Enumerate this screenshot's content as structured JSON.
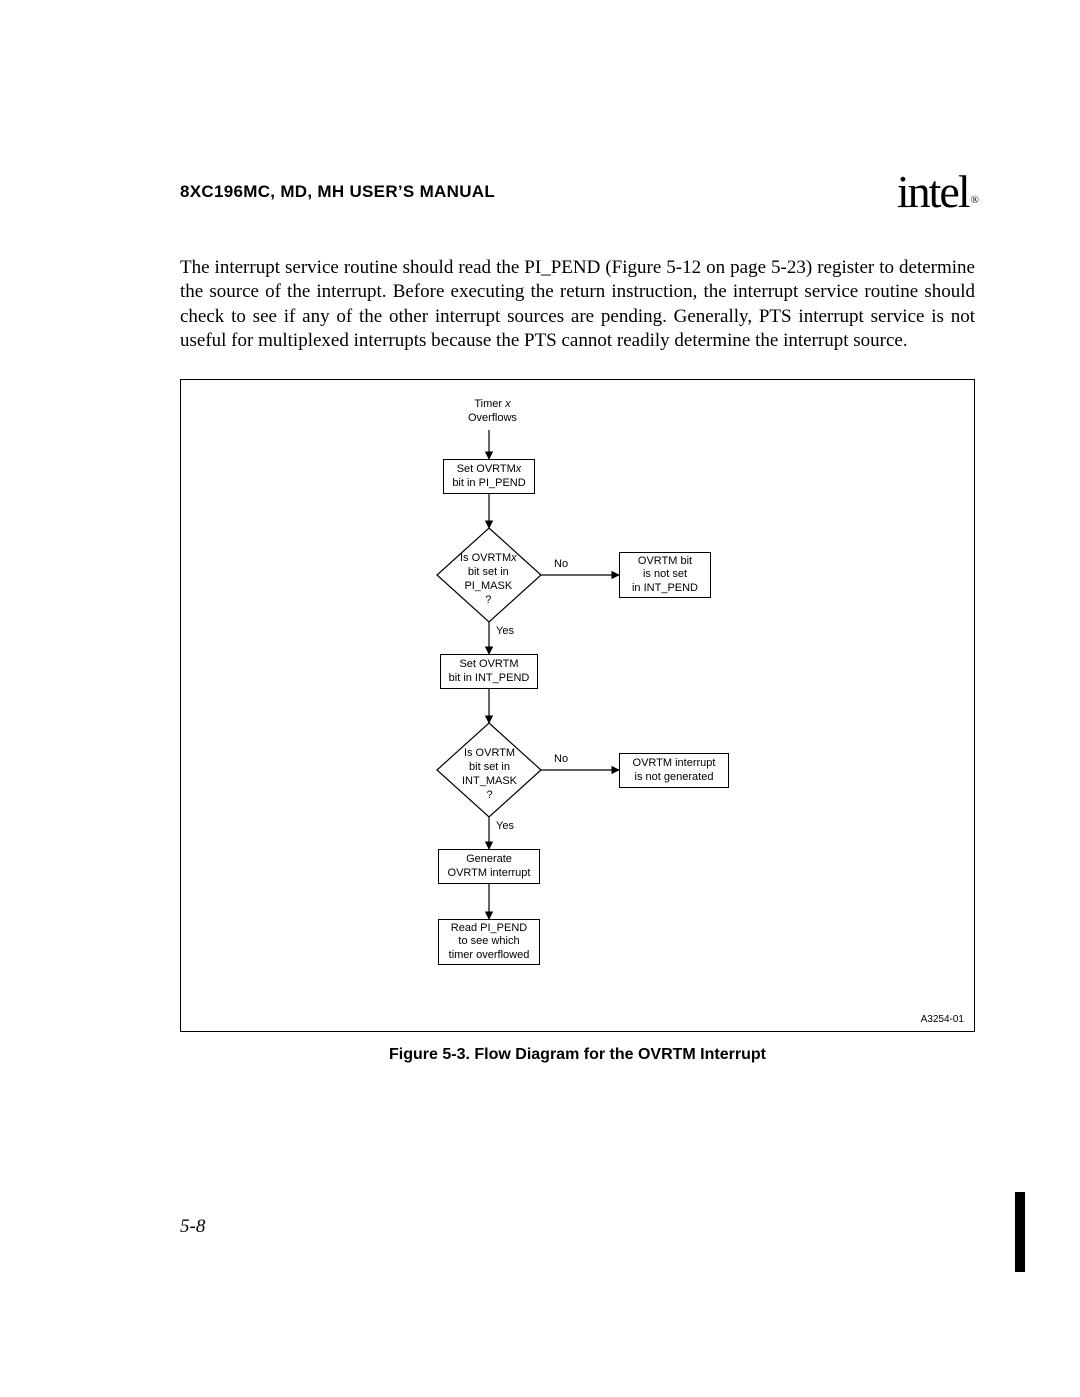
{
  "header": {
    "manual_title": "8XC196MC, MD, MH USER’S MANUAL",
    "logo_text": "intel",
    "logo_reg": "®"
  },
  "paragraph": "The interrupt service routine should read the PI_PEND (Figure 5-12 on page 5-23) register to determine the source of the interrupt. Before executing the return instruction, the interrupt service routine should check to see if any of the other interrupt sources are pending. Generally, PTS interrupt service is not useful for multiplexed interrupts because the PTS cannot readily determine the interrupt source.",
  "flow": {
    "start1": "Timer ",
    "start1_it": "x",
    "start2": "Overflows",
    "box1a": "Set OVRTM",
    "box1a_it": "x",
    "box1b": "bit in PI_PEND",
    "dec1a": "Is OVRTM",
    "dec1a_it": "x",
    "dec1b": "bit set in",
    "dec1c": "PI_MASK",
    "dec1d": "?",
    "dec1_no": "No",
    "dec1_yes": "Yes",
    "side1a": "OVRTM bit",
    "side1b": "is not set",
    "side1c": "in INT_PEND",
    "box2a": "Set OVRTM",
    "box2b": "bit in INT_PEND",
    "dec2a": "Is OVRTM",
    "dec2b": "bit set in",
    "dec2c": "INT_MASK",
    "dec2d": "?",
    "dec2_no": "No",
    "dec2_yes": "Yes",
    "side2a": "OVRTM interrupt",
    "side2b": "is not generated",
    "box3a": "Generate",
    "box3b": "OVRTM interrupt",
    "box4a": "Read PI_PEND",
    "box4b": "to see which",
    "box4c": "timer overflowed",
    "fig_id": "A3254-01"
  },
  "caption": "Figure 5-3.  Flow Diagram for the OVRTM Interrupt",
  "page_number": "5-8",
  "chart_data": {
    "type": "flowchart",
    "nodes": [
      {
        "id": "start",
        "shape": "text",
        "label": "Timer x Overflows"
      },
      {
        "id": "b1",
        "shape": "process",
        "label": "Set OVRTMx bit in PI_PEND"
      },
      {
        "id": "d1",
        "shape": "decision",
        "label": "Is OVRTMx bit set in PI_MASK ?"
      },
      {
        "id": "s1",
        "shape": "process",
        "label": "OVRTM bit is not set in INT_PEND"
      },
      {
        "id": "b2",
        "shape": "process",
        "label": "Set OVRTM bit in INT_PEND"
      },
      {
        "id": "d2",
        "shape": "decision",
        "label": "Is OVRTM bit set in INT_MASK ?"
      },
      {
        "id": "s2",
        "shape": "process",
        "label": "OVRTM interrupt is not generated"
      },
      {
        "id": "b3",
        "shape": "process",
        "label": "Generate OVRTM interrupt"
      },
      {
        "id": "b4",
        "shape": "process",
        "label": "Read PI_PEND to see which timer overflowed"
      }
    ],
    "edges": [
      {
        "from": "start",
        "to": "b1"
      },
      {
        "from": "b1",
        "to": "d1"
      },
      {
        "from": "d1",
        "to": "s1",
        "label": "No"
      },
      {
        "from": "d1",
        "to": "b2",
        "label": "Yes"
      },
      {
        "from": "b2",
        "to": "d2"
      },
      {
        "from": "d2",
        "to": "s2",
        "label": "No"
      },
      {
        "from": "d2",
        "to": "b3",
        "label": "Yes"
      },
      {
        "from": "b3",
        "to": "b4"
      }
    ]
  }
}
